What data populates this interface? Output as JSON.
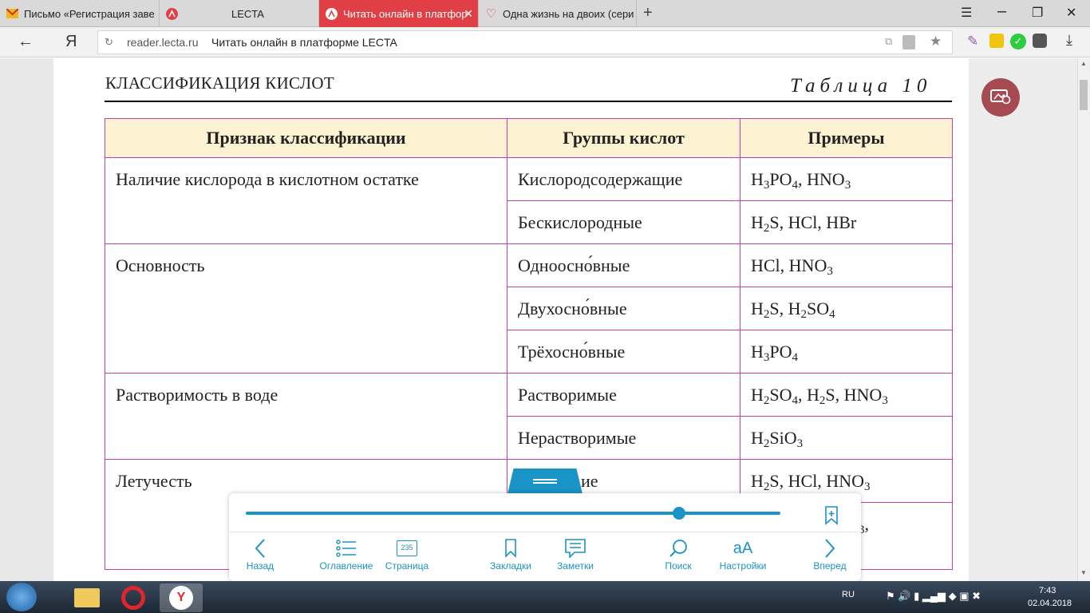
{
  "browser": {
    "tabs": [
      {
        "title": "Письмо «Регистрация заве",
        "icon": "mail-icon"
      },
      {
        "title": "LECTA",
        "icon": "lecta-icon"
      },
      {
        "title": "Читать онлайн в платфор",
        "icon": "lecta-icon",
        "active": true
      },
      {
        "title": "Одна жизнь на двоих (сери",
        "icon": "heart-icon"
      }
    ],
    "url": "reader.lecta.ru",
    "page_title": "Читать онлайн в платформе LECTA",
    "yandex_logo": "Я"
  },
  "document": {
    "title": "КЛАССИФИКАЦИЯ КИСЛОТ",
    "table_number": "Таблица 10",
    "headers": [
      "Признак классификации",
      "Группы кислот",
      "Примеры"
    ],
    "criteria": [
      "Наличие кислорода в кислотном остатке",
      "Основность",
      "Растворимость в воде",
      "Летучесть"
    ],
    "groups": [
      "Кислородсодержащие",
      "Бескислородные",
      "Одноосно́вные",
      "Двухосно́вные",
      "Трёхосно́вные",
      "Растворимые",
      "Нерастворимые",
      "ие",
      ""
    ],
    "examples_html": [
      "H<sub>3</sub>PO<sub>4</sub>, HNO<sub>3</sub>",
      "H<sub>2</sub>S, HCl, HBr",
      "HCl, HNO<sub>3</sub>",
      "H<sub>2</sub>S, H<sub>2</sub>SO<sub>4</sub>",
      "H<sub>3</sub>PO<sub>4</sub>",
      "H<sub>2</sub>SO<sub>4</sub>, H<sub>2</sub>S, HNO<sub>3</sub>",
      "H<sub>2</sub>SiO<sub>3</sub>",
      "H<sub>2</sub>S, HCl, HNO<sub>3</sub>",
      "iO<sub>3</sub>,"
    ]
  },
  "reader": {
    "progress": 0.81,
    "nav": [
      "Назад",
      "Оглавление",
      "Страница",
      "Закладки",
      "Заметки",
      "Поиск",
      "Настройки",
      "Вперед"
    ],
    "page_number": "235"
  },
  "taskbar": {
    "language": "RU",
    "time": "7:43",
    "date": "02.04.2018"
  },
  "colors": {
    "accent": "#1a93c6",
    "table_border": "#c43fa8",
    "header_bg": "#fdf2d1",
    "active_tab": "#e04045"
  }
}
